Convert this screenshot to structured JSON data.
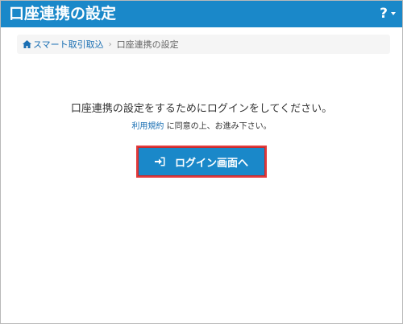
{
  "window": {
    "title": "口座連携の設定",
    "help_label": "?"
  },
  "breadcrumb": {
    "home_label": "スマート取引取込",
    "separator": "›",
    "current": "口座連携の設定"
  },
  "main": {
    "message": "口座連携の設定をするためにログインをしてください。",
    "terms_link": "利用規約",
    "terms_suffix": " に同意の上、お進み下さい。",
    "login_button": "ログイン画面へ"
  },
  "colors": {
    "header": "#1a88c9",
    "button": "#1a88c9",
    "button_highlight": "#e2393b",
    "link": "#1a6fb3"
  },
  "icons": {
    "help": "help-icon",
    "home": "home-icon",
    "login": "sign-in-icon"
  }
}
